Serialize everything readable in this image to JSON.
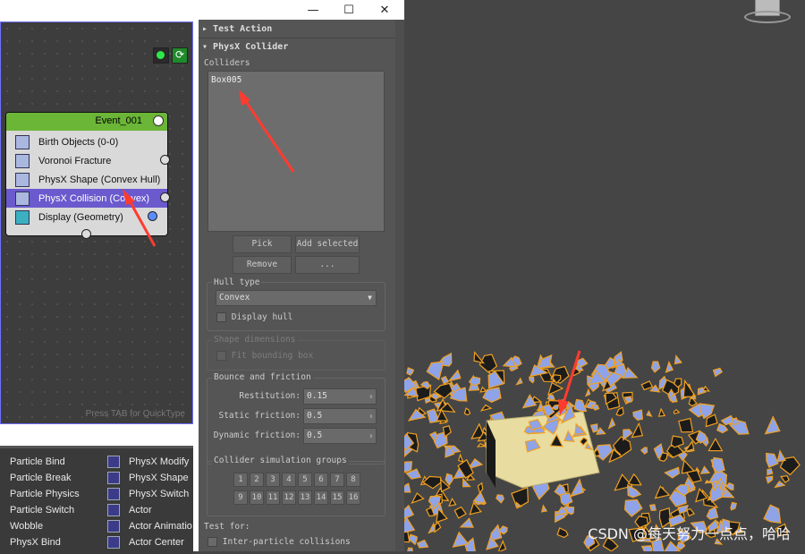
{
  "window": {
    "min_label": "—",
    "max_label": "☐",
    "close_label": "✕"
  },
  "event": {
    "title": "Event_001",
    "operators": [
      {
        "label": "Birth Objects (0-0)",
        "icon": "birth-icon"
      },
      {
        "label": "Voronoi Fracture",
        "icon": "voronoi-icon"
      },
      {
        "label": "PhysX Shape (Convex Hull)",
        "icon": "physx-shape-icon"
      },
      {
        "label": "PhysX Collision (Convex)",
        "icon": "physx-collision-icon"
      },
      {
        "label": "Display (Geometry)",
        "icon": "display-icon"
      }
    ]
  },
  "graph": {
    "hint": "Press TAB for QuickType"
  },
  "depot": {
    "col1": [
      "Particle Bind",
      "Particle Break",
      "Particle Physics",
      "Particle Switch",
      "Wobble",
      "PhysX Bind"
    ],
    "col2": [
      "PhysX Modify",
      "PhysX Shape",
      "PhysX Switch",
      "Actor",
      "Actor Animatio",
      "Actor Center"
    ]
  },
  "panel": {
    "test_action": "Test Action",
    "collider_title": "PhysX Collider",
    "colliders_label": "Colliders",
    "collider_item": "Box005",
    "pick": "Pick",
    "add_selected": "Add selected",
    "remove": "Remove",
    "more": "...",
    "hull_type_label": "Hull type",
    "hull_type_value": "Convex",
    "display_hull": "Display hull",
    "shape_dimensions": "Shape dimensions",
    "fit_bounding_box": "Fit bounding box",
    "bounce_friction": "Bounce and friction",
    "restitution_label": "Restitution:",
    "restitution_value": "0.15",
    "static_label": "Static friction:",
    "static_value": "0.5",
    "dynamic_label": "Dynamic friction:",
    "dynamic_value": "0.5",
    "sim_groups": "Collider simulation groups",
    "groups": [
      "1",
      "2",
      "3",
      "4",
      "5",
      "6",
      "7",
      "8",
      "9",
      "10",
      "11",
      "12",
      "13",
      "14",
      "15",
      "16"
    ],
    "test_for": "Test for:",
    "inter_particle": "Inter-particle collisions"
  },
  "watermark": "CSDN @每天努力一点点，哈哈",
  "colors": {
    "event_header": "#6bb537",
    "selected_op": "#6a5acd",
    "box": "#e8dca0",
    "shard_fill": "#8fa3e8",
    "shard_edge": "#f0a020",
    "arrow": "#ff3b30"
  }
}
